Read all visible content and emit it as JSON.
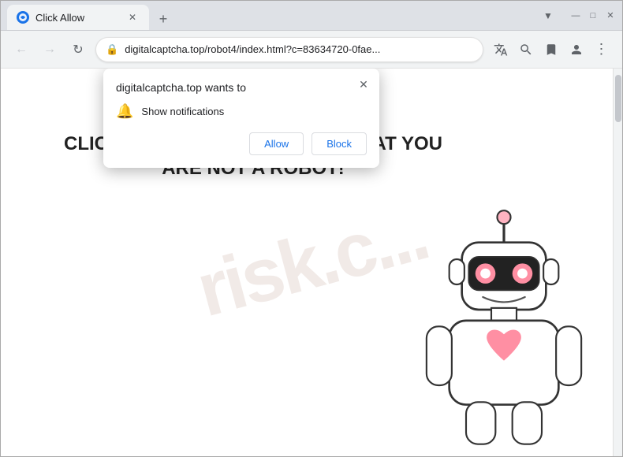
{
  "browser": {
    "tab": {
      "title": "Click Allow",
      "favicon_label": "⊕"
    },
    "window_controls": {
      "minimize": "—",
      "maximize": "□",
      "close": "✕"
    },
    "toolbar": {
      "back": "←",
      "forward": "→",
      "refresh": "↻",
      "address": "digitalcaptcha.top/robot4/index.html?c=83634720-0fae...",
      "new_tab": "+"
    }
  },
  "popup": {
    "title": "digitalcaptcha.top wants to",
    "permission_label": "Show notifications",
    "allow_button": "Allow",
    "block_button": "Block",
    "close_symbol": "✕"
  },
  "page": {
    "headline_line1": "CLICK «ALLOW» TO CONFIRM THAT YOU",
    "headline_line2": "ARE NOT A ROBOT!",
    "watermark": "risk.c..."
  }
}
